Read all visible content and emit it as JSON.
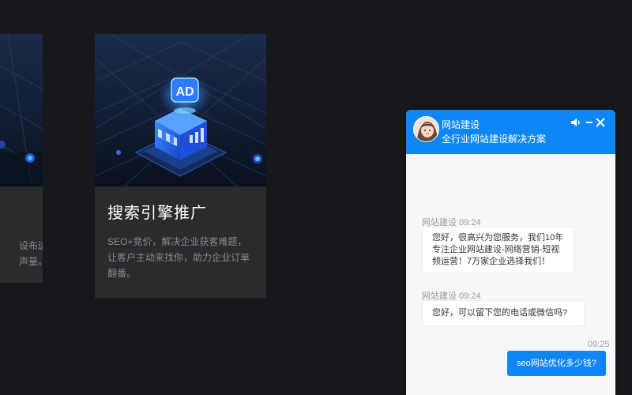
{
  "cards": {
    "left": {
      "desc": "设布运\n声量。"
    },
    "main": {
      "title": "搜索引擎推广",
      "desc": "SEO+竞价，解决企业获客难题，让客户主动来找你，助力企业订单翻番。",
      "image_icon": "ad-3d-icon",
      "image_text": "AD"
    }
  },
  "chat": {
    "name": "网站建设",
    "subtitle": "全行业网站建设解决方案",
    "icons": [
      "sound-icon",
      "minimize-icon",
      "close-icon"
    ],
    "accent": "#0f86f5",
    "messages": [
      {
        "from": "agent",
        "meta": "网站建设 09:24",
        "text": "您好，很高兴为您服务，我们10年专注企业网站建设-网络营销-短视频运营！7万家企业选择我们！"
      },
      {
        "from": "agent",
        "meta": "网站建设 09:24",
        "text": "您好，可以留下您的电话或微信吗?"
      },
      {
        "from": "user",
        "meta": "09:25",
        "text": "seo网站优化多少钱?"
      }
    ]
  }
}
